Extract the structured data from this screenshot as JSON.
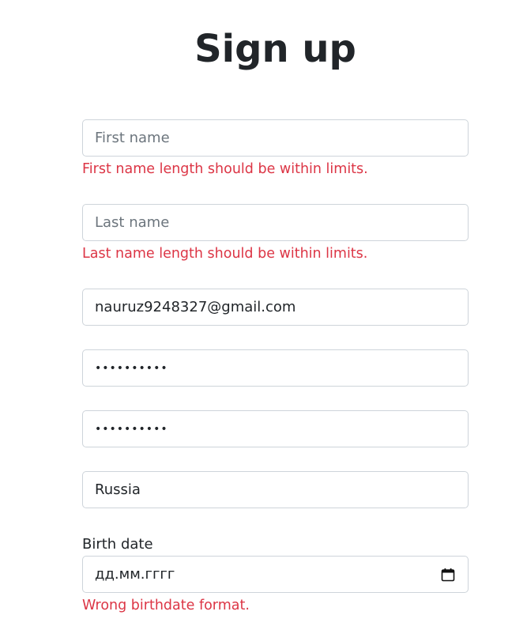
{
  "page_title": "Sign up",
  "form": {
    "first_name": {
      "placeholder": "First name",
      "value": "",
      "error": "First name length should be within limits."
    },
    "last_name": {
      "placeholder": "Last name",
      "value": "",
      "error": "Last name length should be within limits."
    },
    "email": {
      "value": "nauruz9248327@gmail.com"
    },
    "password": {
      "masked": "••••••••••"
    },
    "confirm_password": {
      "masked": "••••••••••"
    },
    "country": {
      "value": "Russia"
    },
    "birth_date": {
      "label": "Birth date",
      "placeholder": "дд.мм.гггг",
      "error": "Wrong birthdate format.",
      "icon": "calendar-icon"
    }
  },
  "colors": {
    "text": "#212529",
    "placeholder": "#6c757d",
    "error": "#dc3545",
    "border": "#ced4da"
  }
}
